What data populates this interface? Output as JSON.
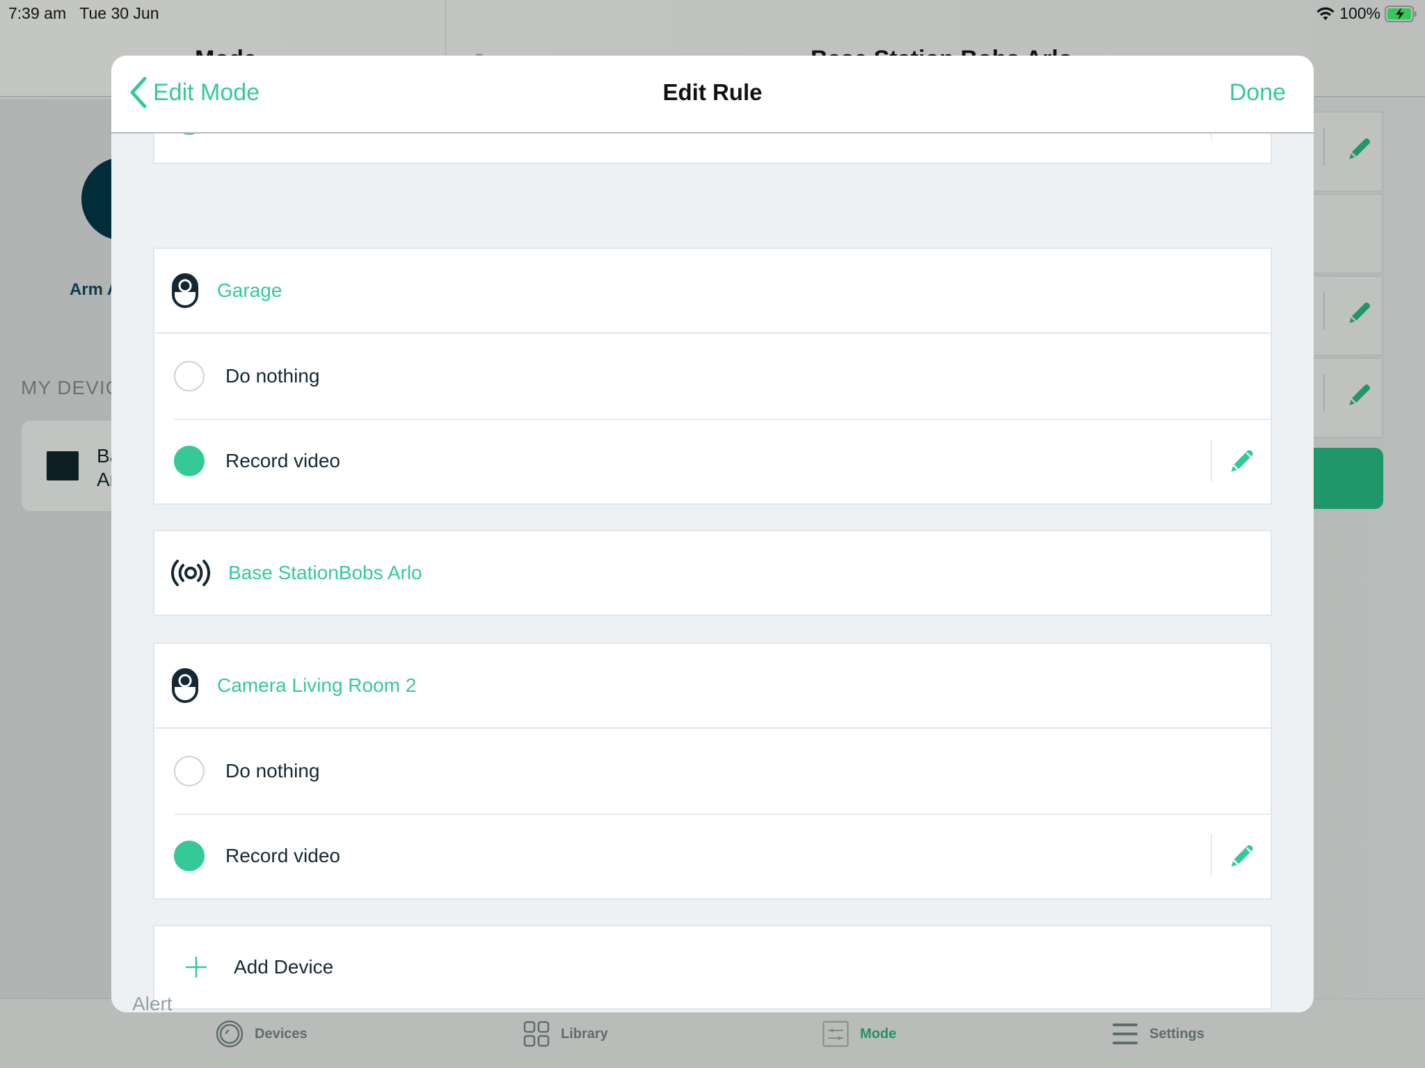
{
  "status_bar": {
    "time": "7:39 am",
    "date": "Tue 30 Jun",
    "battery_percent": "100%",
    "wifi_icon": "wifi-icon",
    "battery_icon": "battery-charging-icon"
  },
  "background": {
    "left_title": "Mode",
    "right_title": "Base Station Bobs Arlo",
    "mode_label": "Arm A",
    "section_title": "MY DEVIC",
    "device_card_line1": "Ba",
    "device_card_line2": "Ar"
  },
  "modal": {
    "back_label": "Edit Mode",
    "title": "Edit Rule",
    "done_label": "Done",
    "devices": [
      {
        "name": "Garage",
        "icon": "camera-icon",
        "options": [
          {
            "label": "Do nothing",
            "selected": false,
            "editable": false
          },
          {
            "label": "Record video",
            "selected": true,
            "editable": true
          }
        ]
      },
      {
        "name": "Base StationBobs Arlo",
        "icon": "base-station-icon",
        "options": []
      },
      {
        "name": "Camera Living Room 2",
        "icon": "camera-icon",
        "options": [
          {
            "label": "Do nothing",
            "selected": false,
            "editable": false
          },
          {
            "label": "Record video",
            "selected": true,
            "editable": true
          }
        ]
      }
    ],
    "add_device_label": "Add Device",
    "next_section_label": "Alert"
  },
  "tab_bar": {
    "tabs": [
      {
        "label": "Devices",
        "icon": "devices-icon",
        "active": false
      },
      {
        "label": "Library",
        "icon": "library-icon",
        "active": false
      },
      {
        "label": "Mode",
        "icon": "mode-icon",
        "active": true
      },
      {
        "label": "Settings",
        "icon": "settings-icon",
        "active": false
      }
    ]
  },
  "colors": {
    "accent": "#34c997",
    "accent_dark": "#1e946a",
    "text_dark": "#142833",
    "modal_bg": "#edf1f4"
  }
}
